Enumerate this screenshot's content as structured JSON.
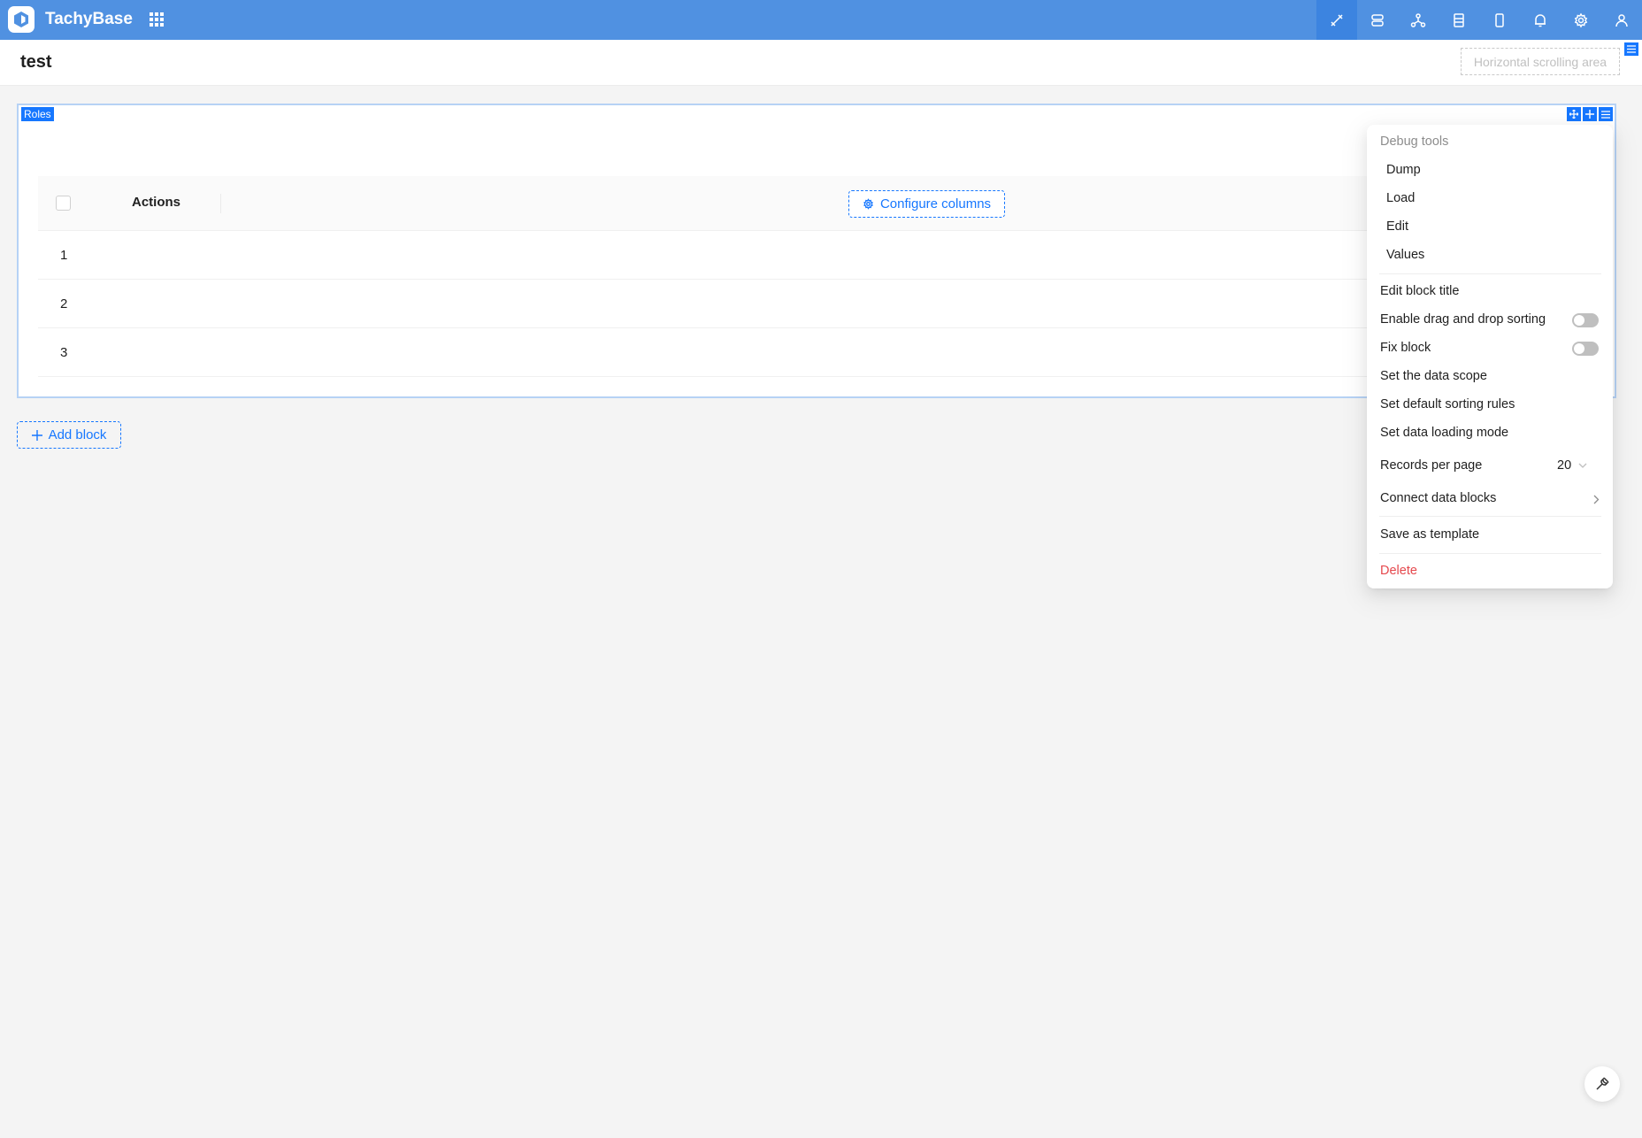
{
  "app": {
    "name": "TachyBase"
  },
  "header": {
    "title": "test",
    "hscroll_label": "Horizontal scrolling area"
  },
  "block": {
    "tag": "Roles",
    "table": {
      "actions_header": "Actions",
      "configure_label": "Configure columns",
      "rows": [
        "1",
        "2",
        "3"
      ]
    }
  },
  "add_block_label": "Add block",
  "menu": {
    "debug_group": "Debug tools",
    "debug_items": [
      "Dump",
      "Load",
      "Edit",
      "Values"
    ],
    "edit_title": "Edit block title",
    "drag_sort": "Enable drag and drop sorting",
    "fix_block": "Fix block",
    "data_scope": "Set the data scope",
    "sorting_rules": "Set default sorting rules",
    "loading_mode": "Set data loading mode",
    "records_per_page": "Records per page",
    "records_per_page_value": "20",
    "connect_blocks": "Connect data blocks",
    "save_template": "Save as template",
    "delete": "Delete"
  },
  "colors": {
    "topbar": "#5091e1",
    "accent": "#1677ff",
    "danger": "#e5484d"
  }
}
